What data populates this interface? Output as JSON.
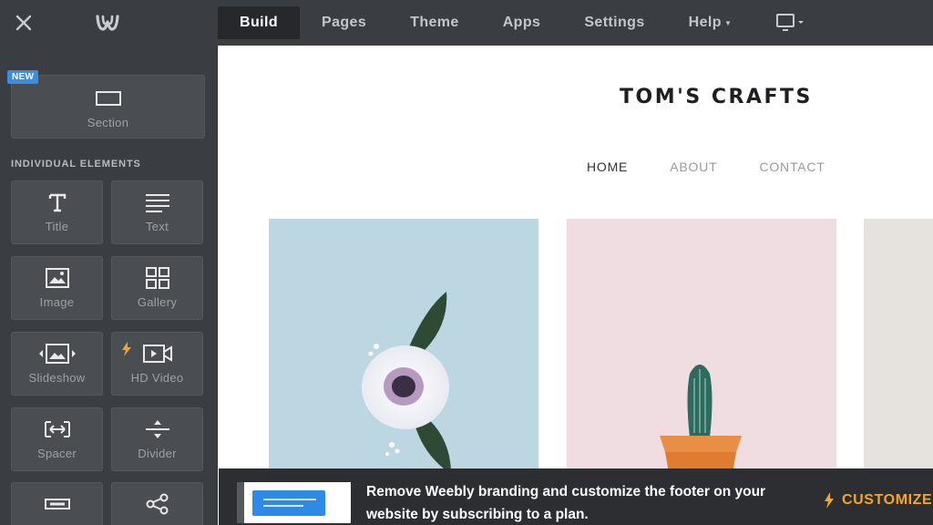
{
  "topbar": {
    "tabs": [
      {
        "label": "Build",
        "active": true
      },
      {
        "label": "Pages"
      },
      {
        "label": "Theme"
      },
      {
        "label": "Apps"
      },
      {
        "label": "Settings"
      },
      {
        "label": "Help",
        "has_dropdown": true
      }
    ],
    "icons": [
      "close-icon",
      "weebly-logo",
      "desktop-device-icon"
    ]
  },
  "sidebar": {
    "new_badge": "NEW",
    "section_tile": {
      "label": "Section",
      "icon": "section-icon"
    },
    "heading": "INDIVIDUAL ELEMENTS",
    "elements": [
      {
        "label": "Title",
        "icon": "title-icon"
      },
      {
        "label": "Text",
        "icon": "text-icon"
      },
      {
        "label": "Image",
        "icon": "image-icon"
      },
      {
        "label": "Gallery",
        "icon": "gallery-icon"
      },
      {
        "label": "Slideshow",
        "icon": "slideshow-icon"
      },
      {
        "label": "HD Video",
        "icon": "hd-video-icon",
        "premium": true
      },
      {
        "label": "Spacer",
        "icon": "spacer-icon"
      },
      {
        "label": "Divider",
        "icon": "divider-icon"
      },
      {
        "label": "",
        "icon": "button-icon"
      },
      {
        "label": "",
        "icon": "social-share-icon"
      }
    ]
  },
  "site": {
    "title": "TOM'S CRAFTS",
    "nav": [
      "HOME",
      "ABOUT",
      "CONTACT"
    ]
  },
  "banner": {
    "text": "Remove Weebly branding and customize the footer on your website by subscribing to a plan.",
    "cta": "CUSTOMIZE"
  },
  "colors": {
    "chrome": "#3a3d42",
    "active_tab": "#26282c",
    "tile": "#4a4d52",
    "badge": "#3c8de0",
    "accent_orange": "#f5a623"
  }
}
